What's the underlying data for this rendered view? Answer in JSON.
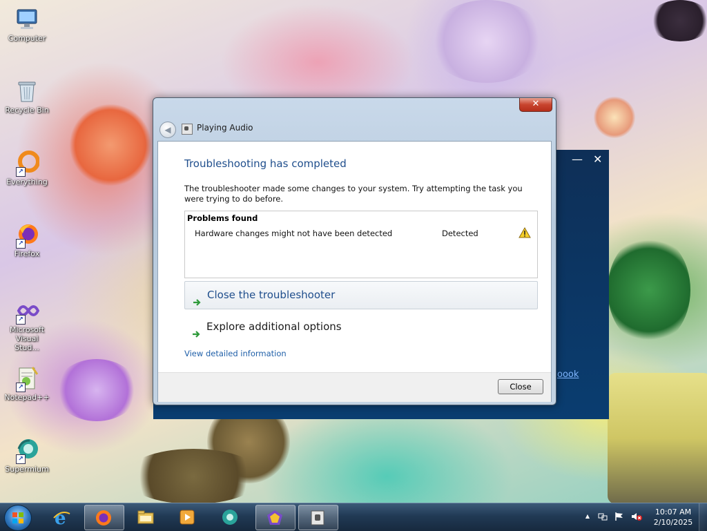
{
  "desktop": {
    "icons": [
      {
        "label": "Computer",
        "icon": "computer-icon"
      },
      {
        "label": "Recycle Bin",
        "icon": "recycle-bin-icon"
      },
      {
        "label": "Everything",
        "icon": "everything-icon"
      },
      {
        "label": "Firefox",
        "icon": "firefox-icon"
      },
      {
        "label": "Microsoft Visual Stud...",
        "icon": "visual-studio-icon"
      },
      {
        "label": "Notepad++",
        "icon": "notepadpp-icon"
      },
      {
        "label": "Supermium",
        "icon": "supermium-icon"
      }
    ]
  },
  "background_window": {
    "minimize_glyph": "—",
    "close_glyph": "✕",
    "link_fragment": "oook"
  },
  "troubleshooter": {
    "window_title": "Playing Audio",
    "close_glyph": "✕",
    "back_glyph": "◀",
    "heading": "Troubleshooting has completed",
    "description": "The troubleshooter made some changes to your system. Try attempting the task you were trying to do before.",
    "problems": {
      "title": "Problems found",
      "items": [
        {
          "name": "Hardware changes might not have been detected",
          "status": "Detected",
          "icon": "warning-icon"
        }
      ]
    },
    "commands": {
      "close_troubleshooter": "Close the troubleshooter",
      "explore_options": "Explore additional options"
    },
    "view_details": "View detailed information",
    "close_button": "Close"
  },
  "taskbar": {
    "items": [
      {
        "name": "internet-explorer",
        "active": false
      },
      {
        "name": "firefox",
        "active": true
      },
      {
        "name": "file-explorer",
        "active": false
      },
      {
        "name": "media-player",
        "active": false
      },
      {
        "name": "supermium",
        "active": false
      },
      {
        "name": "everything-app",
        "active": true
      },
      {
        "name": "troubleshooter-app",
        "active": true
      }
    ],
    "tray": {
      "show_hidden_glyph": "▲",
      "time": "10:07 AM",
      "date": "2/10/2025"
    }
  },
  "colors": {
    "heading_blue": "#1f4e8c",
    "link_blue": "#1f5fa8",
    "taskbar": "#213a55",
    "close_red": "#c8442e"
  }
}
